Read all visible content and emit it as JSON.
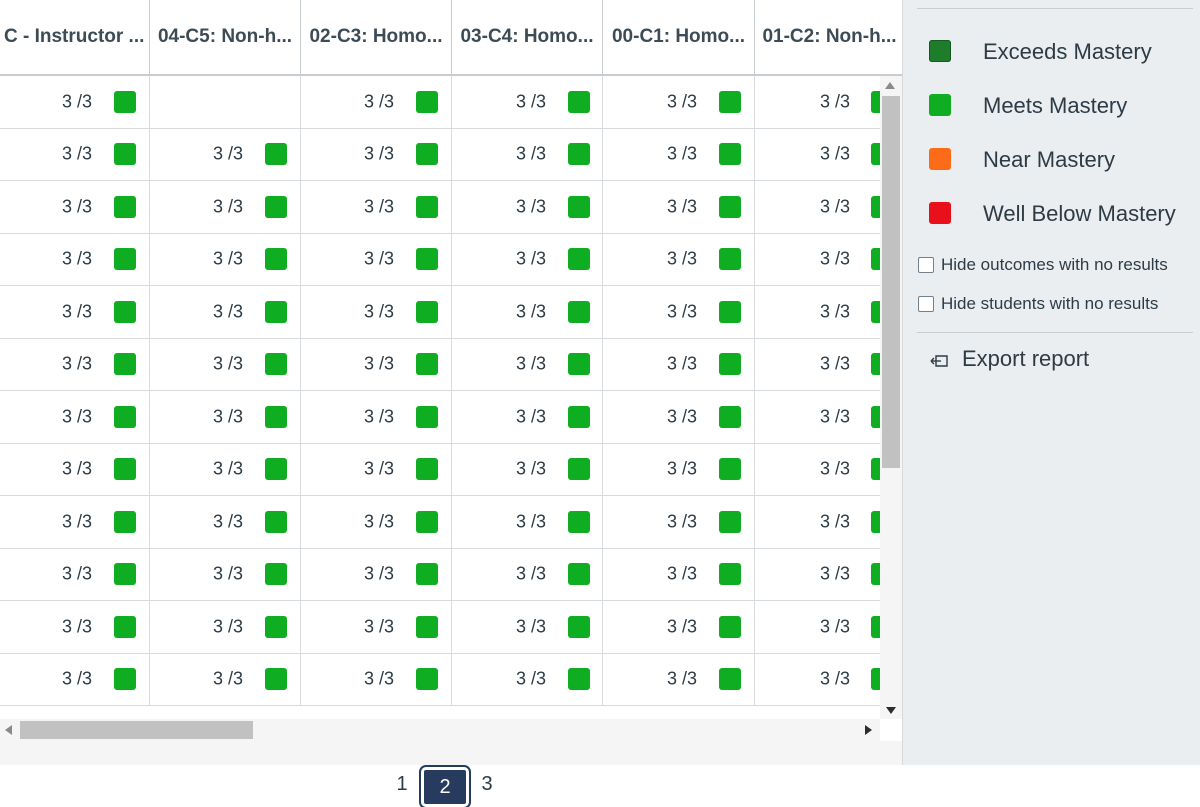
{
  "colors": {
    "exceeds": "#1d7d2b",
    "meets": "#0fad22",
    "near": "#fc6c18",
    "well_below": "#e8101a",
    "page_current": "#263b5e"
  },
  "grid": {
    "columns": [
      {
        "label": "C - Instructor ..."
      },
      {
        "label": "04-C5: Non-h..."
      },
      {
        "label": "02-C3: Homo..."
      },
      {
        "label": "03-C4: Homo..."
      },
      {
        "label": "00-C1: Homo..."
      },
      {
        "label": "01-C2: Non-h..."
      }
    ],
    "rows": [
      [
        "3 /3",
        "",
        "3 /3",
        "3 /3",
        "3 /3",
        "3 /3"
      ],
      [
        "3 /3",
        "3 /3",
        "3 /3",
        "3 /3",
        "3 /3",
        "3 /3"
      ],
      [
        "3 /3",
        "3 /3",
        "3 /3",
        "3 /3",
        "3 /3",
        "3 /3"
      ],
      [
        "3 /3",
        "3 /3",
        "3 /3",
        "3 /3",
        "3 /3",
        "3 /3"
      ],
      [
        "3 /3",
        "3 /3",
        "3 /3",
        "3 /3",
        "3 /3",
        "3 /3"
      ],
      [
        "3 /3",
        "3 /3",
        "3 /3",
        "3 /3",
        "3 /3",
        "3 /3"
      ],
      [
        "3 /3",
        "3 /3",
        "3 /3",
        "3 /3",
        "3 /3",
        "3 /3"
      ],
      [
        "3 /3",
        "3 /3",
        "3 /3",
        "3 /3",
        "3 /3",
        "3 /3"
      ],
      [
        "3 /3",
        "3 /3",
        "3 /3",
        "3 /3",
        "3 /3",
        "3 /3"
      ],
      [
        "3 /3",
        "3 /3",
        "3 /3",
        "3 /3",
        "3 /3",
        "3 /3"
      ],
      [
        "3 /3",
        "3 /3",
        "3 /3",
        "3 /3",
        "3 /3",
        "3 /3"
      ],
      [
        "3 /3",
        "3 /3",
        "3 /3",
        "3 /3",
        "3 /3",
        "3 /3"
      ]
    ],
    "cell_status": "meets"
  },
  "sidebar": {
    "legend": [
      {
        "label": "Exceeds Mastery",
        "color_key": "exceeds"
      },
      {
        "label": "Meets Mastery",
        "color_key": "meets"
      },
      {
        "label": "Near Mastery",
        "color_key": "near"
      },
      {
        "label": "Well Below Mastery",
        "color_key": "well_below"
      }
    ],
    "hide_outcomes_label": "Hide outcomes with no results",
    "hide_outcomes_checked": false,
    "hide_students_label": "Hide students with no results",
    "hide_students_checked": false,
    "export_label": "Export report",
    "export_icon": "export-icon"
  },
  "pagination": {
    "pages": [
      "1",
      "2",
      "3"
    ],
    "current": "2"
  }
}
